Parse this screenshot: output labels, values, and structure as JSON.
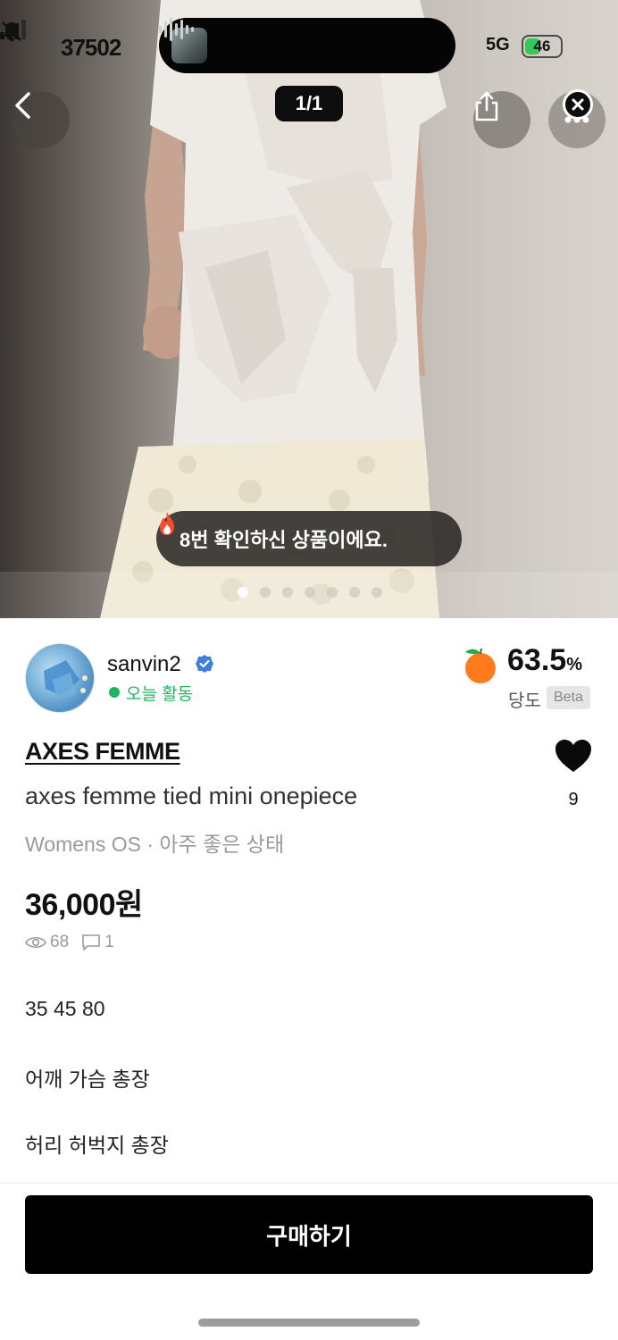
{
  "status_bar": {
    "time": "37502",
    "network": "5G",
    "battery": "46",
    "battery_level": 0.46
  },
  "gallery": {
    "counter": "1/1",
    "toast": "8번 확인하신 상품이에요.",
    "dot_count": 7,
    "active_dot": 0
  },
  "seller": {
    "name": "sanvin2",
    "status": "오늘 활동",
    "rate_value": "63.5",
    "rate_unit": "%",
    "rate_label": "당도",
    "rate_badge": "Beta"
  },
  "product": {
    "brand": "AXES FEMME",
    "title": "axes femme tied mini onepiece",
    "meta": "Womens OS · 아주 좋은 상태",
    "price": "36,000원",
    "likes": "9",
    "views": "68",
    "comments": "1"
  },
  "description": [
    "35 45 80",
    "어깨 가슴 총장",
    "허리 허벅지 총장"
  ],
  "actions": {
    "buy": "구매하기"
  },
  "colors": {
    "active_green": "#22b35e",
    "verified_blue": "#3d7fe0",
    "primary": "#000000"
  },
  "icons": [
    "back-arrow-icon",
    "share-icon",
    "more-icon",
    "close-icon",
    "fire-icon",
    "verified-icon",
    "orange-icon",
    "heart-icon",
    "eye-icon",
    "comment-icon"
  ]
}
